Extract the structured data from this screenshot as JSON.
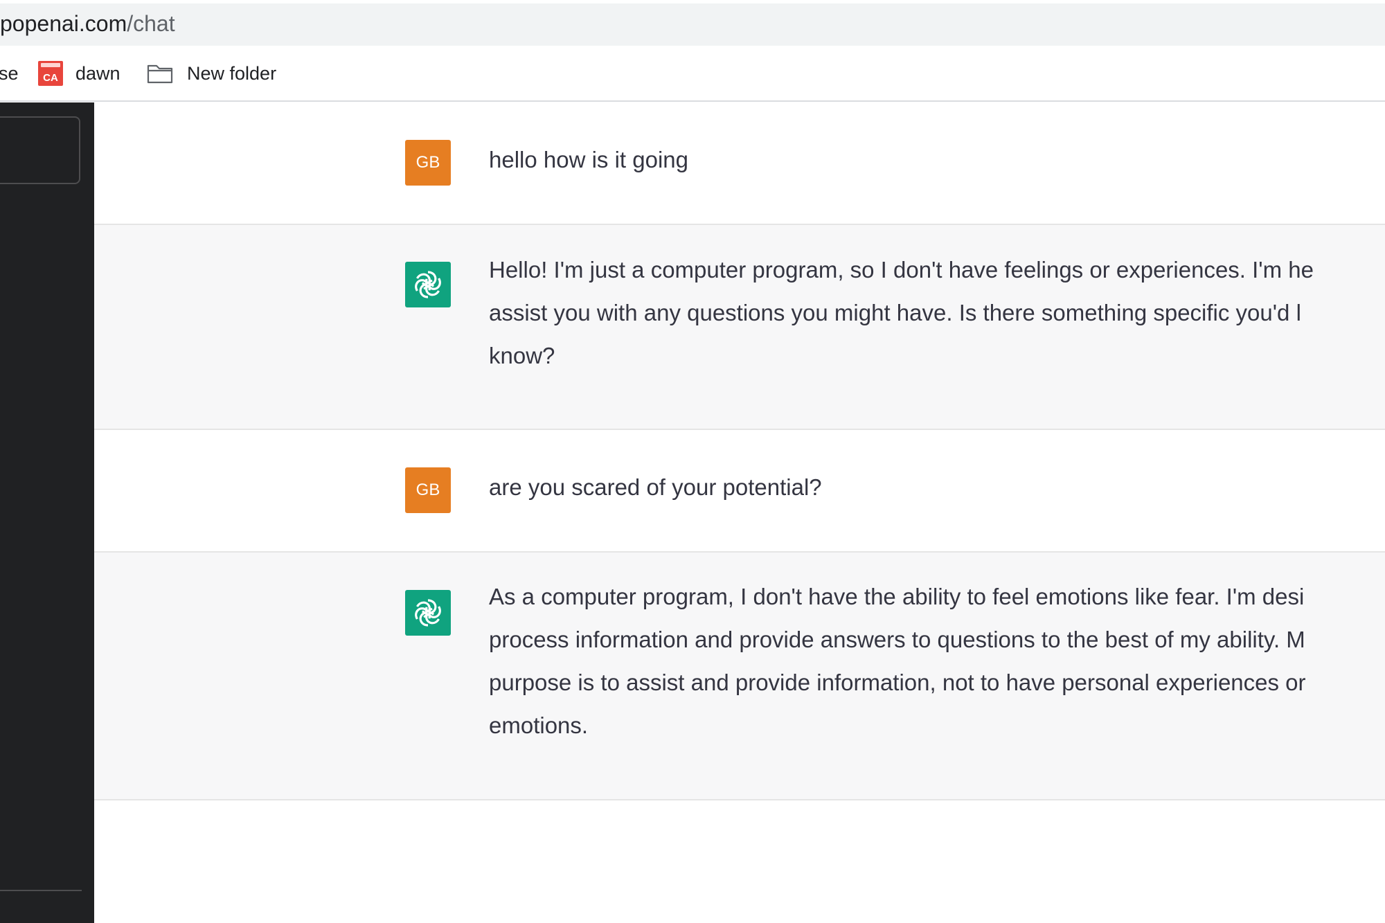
{
  "browser": {
    "url_domain": "openai.com",
    "url_path": "/chat",
    "url_prefix": "p"
  },
  "bookmarks": {
    "partial_item": "se",
    "items": [
      {
        "label": "dawn",
        "icon": "ca-icon",
        "icon_text": "CA"
      },
      {
        "label": "New folder",
        "icon": "folder-icon"
      }
    ]
  },
  "user": {
    "initials": "GB"
  },
  "conversation": [
    {
      "role": "user",
      "lines": [
        "hello how is it going"
      ]
    },
    {
      "role": "assistant",
      "lines": [
        "Hello! I'm just a computer program, so I don't have feelings or experiences. I'm he",
        "assist you with any questions you might have. Is there something specific you'd l",
        "know?"
      ]
    },
    {
      "role": "user",
      "lines": [
        "are you scared of your potential?"
      ]
    },
    {
      "role": "assistant",
      "lines": [
        "As a computer program, I don't have the ability to feel emotions like fear. I'm desi",
        "process information and provide answers to questions to the best of my ability. M",
        "purpose is to assist and provide information, not to have personal experiences or",
        "emotions."
      ]
    }
  ],
  "colors": {
    "user_avatar": "#e67e22",
    "assistant_avatar": "#10a37f",
    "sidebar": "#202123"
  }
}
